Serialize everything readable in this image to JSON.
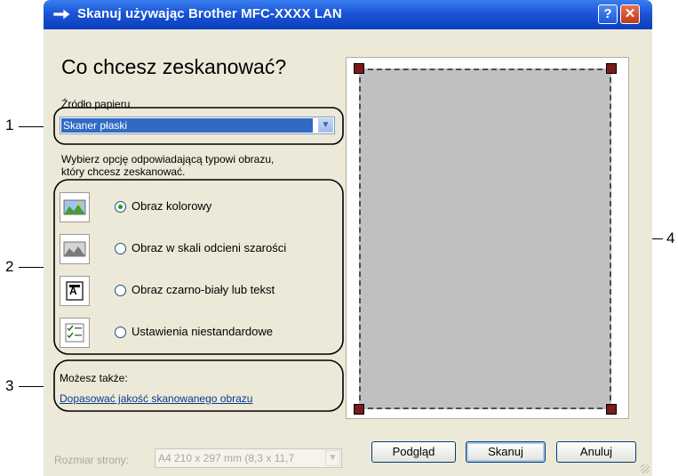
{
  "callouts": [
    "1",
    "2",
    "3",
    "4"
  ],
  "window": {
    "title": "Skanuj używając Brother MFC-XXXX  LAN",
    "help_button": "?",
    "close_button": "✕"
  },
  "heading": "Co chcesz zeskanować?",
  "paper_source": {
    "label": "Źródło papieru",
    "value": "Skaner płaski"
  },
  "instruction": {
    "line1": "Wybierz opcję odpowiadającą typowi obrazu,",
    "line2": "który chcesz zeskanować."
  },
  "options": [
    {
      "label": "Obraz kolorowy",
      "selected": true,
      "icon": "color-image-icon"
    },
    {
      "label": "Obraz w skali odcieni szarości",
      "selected": false,
      "icon": "grayscale-image-icon"
    },
    {
      "label": "Obraz czarno-biały lub tekst",
      "selected": false,
      "icon": "bw-text-icon"
    },
    {
      "label": "Ustawienia niestandardowe",
      "selected": false,
      "icon": "custom-settings-icon"
    }
  ],
  "also": {
    "label": "Możesz także:",
    "link": "Dopasować jakość skanowanego obrazu"
  },
  "page_size": {
    "label": "Rozmiar strony:",
    "value": "A4 210 x 297 mm (8,3 x 11,7"
  },
  "buttons": {
    "preview": "Podgląd",
    "scan": "Skanuj",
    "cancel": "Anuluj"
  },
  "colors": {
    "titlebar": "#0a3fbd",
    "window_bg": "#ece9d8",
    "selection": "#316ac5",
    "preview_area": "#c0c0c0",
    "handle": "#7a1a1a"
  }
}
